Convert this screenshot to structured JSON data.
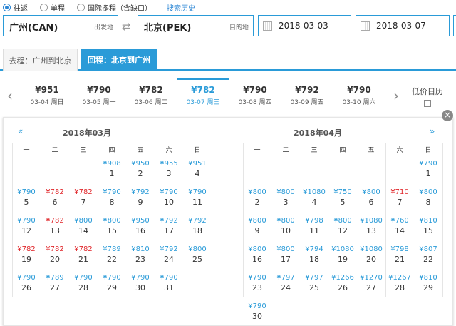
{
  "trip_type": {
    "options": [
      {
        "label": "往返",
        "selected": true
      },
      {
        "label": "单程",
        "selected": false
      },
      {
        "label": "国际多程（含缺口）",
        "selected": false
      }
    ],
    "history_link": "搜索历史"
  },
  "search": {
    "from_city": "广州(CAN)",
    "from_tag": "出发地",
    "to_city": "北京(PEK)",
    "to_tag": "目的地",
    "depart_date": "2018-03-03",
    "return_date": "2018-03-07",
    "swap_icon": "swap-icon",
    "calendar_icon": "calendar-icon"
  },
  "legs": {
    "outbound": "去程：广州到北京",
    "return": "回程：北京到广州"
  },
  "date_strip": {
    "days": [
      {
        "price": "¥951",
        "date": "03-04 周日",
        "selected": false
      },
      {
        "price": "¥790",
        "date": "03-05 周一",
        "selected": false
      },
      {
        "price": "¥782",
        "date": "03-06 周二",
        "selected": false
      },
      {
        "price": "¥782",
        "date": "03-07 周三",
        "selected": true
      },
      {
        "price": "¥790",
        "date": "03-08 周四",
        "selected": false
      },
      {
        "price": "¥792",
        "date": "03-09 周五",
        "selected": false
      },
      {
        "price": "¥790",
        "date": "03-10 周六",
        "selected": false
      }
    ],
    "low_price_calendar": "低价日历"
  },
  "calendar": {
    "close_icon": "×",
    "prev_icon": "«",
    "next_icon": "»",
    "weekdays": [
      "一",
      "二",
      "三",
      "四",
      "五",
      "六",
      "日"
    ],
    "colors": {
      "normal": "#2a9bd8",
      "low": "#e0262a"
    },
    "months": [
      {
        "title": "2018年03月",
        "first_weekday": 3,
        "days": [
          {
            "d": "1",
            "p": "¥908",
            "low": false
          },
          {
            "d": "2",
            "p": "¥950",
            "low": false
          },
          {
            "d": "3",
            "p": "¥955",
            "low": false
          },
          {
            "d": "4",
            "p": "¥951",
            "low": false
          },
          {
            "d": "5",
            "p": "¥790",
            "low": false
          },
          {
            "d": "6",
            "p": "¥782",
            "low": true
          },
          {
            "d": "7",
            "p": "¥782",
            "low": true
          },
          {
            "d": "8",
            "p": "¥790",
            "low": false
          },
          {
            "d": "9",
            "p": "¥792",
            "low": false
          },
          {
            "d": "10",
            "p": "¥790",
            "low": false
          },
          {
            "d": "11",
            "p": "¥790",
            "low": false
          },
          {
            "d": "12",
            "p": "¥790",
            "low": false
          },
          {
            "d": "13",
            "p": "¥782",
            "low": true
          },
          {
            "d": "14",
            "p": "¥800",
            "low": false
          },
          {
            "d": "15",
            "p": "¥800",
            "low": false
          },
          {
            "d": "16",
            "p": "¥950",
            "low": false
          },
          {
            "d": "17",
            "p": "¥792",
            "low": false
          },
          {
            "d": "18",
            "p": "¥792",
            "low": false
          },
          {
            "d": "19",
            "p": "¥782",
            "low": true
          },
          {
            "d": "20",
            "p": "¥782",
            "low": true
          },
          {
            "d": "21",
            "p": "¥782",
            "low": true
          },
          {
            "d": "22",
            "p": "¥789",
            "low": false
          },
          {
            "d": "23",
            "p": "¥810",
            "low": false
          },
          {
            "d": "24",
            "p": "¥792",
            "low": false
          },
          {
            "d": "25",
            "p": "¥800",
            "low": false
          },
          {
            "d": "26",
            "p": "¥790",
            "low": false
          },
          {
            "d": "27",
            "p": "¥789",
            "low": false
          },
          {
            "d": "28",
            "p": "¥790",
            "low": false
          },
          {
            "d": "29",
            "p": "¥790",
            "low": false
          },
          {
            "d": "30",
            "p": "¥790",
            "low": false
          },
          {
            "d": "31",
            "p": "¥790",
            "low": false
          }
        ]
      },
      {
        "title": "2018年04月",
        "first_weekday": 6,
        "days": [
          {
            "d": "1",
            "p": "¥790",
            "low": false
          },
          {
            "d": "2",
            "p": "¥800",
            "low": false
          },
          {
            "d": "3",
            "p": "¥800",
            "low": false
          },
          {
            "d": "4",
            "p": "¥1080",
            "low": false
          },
          {
            "d": "5",
            "p": "¥750",
            "low": false
          },
          {
            "d": "6",
            "p": "¥800",
            "low": false
          },
          {
            "d": "7",
            "p": "¥710",
            "low": true
          },
          {
            "d": "8",
            "p": "¥800",
            "low": false
          },
          {
            "d": "9",
            "p": "¥800",
            "low": false
          },
          {
            "d": "10",
            "p": "¥800",
            "low": false
          },
          {
            "d": "11",
            "p": "¥798",
            "low": false
          },
          {
            "d": "12",
            "p": "¥800",
            "low": false
          },
          {
            "d": "13",
            "p": "¥1080",
            "low": false
          },
          {
            "d": "14",
            "p": "¥760",
            "low": false
          },
          {
            "d": "15",
            "p": "¥810",
            "low": false
          },
          {
            "d": "16",
            "p": "¥800",
            "low": false
          },
          {
            "d": "17",
            "p": "¥800",
            "low": false
          },
          {
            "d": "18",
            "p": "¥794",
            "low": false
          },
          {
            "d": "19",
            "p": "¥1080",
            "low": false
          },
          {
            "d": "20",
            "p": "¥1080",
            "low": false
          },
          {
            "d": "21",
            "p": "¥798",
            "low": false
          },
          {
            "d": "22",
            "p": "¥807",
            "low": false
          },
          {
            "d": "23",
            "p": "¥790",
            "low": false
          },
          {
            "d": "24",
            "p": "¥797",
            "low": false
          },
          {
            "d": "25",
            "p": "¥797",
            "low": false
          },
          {
            "d": "26",
            "p": "¥1266",
            "low": false
          },
          {
            "d": "27",
            "p": "¥1270",
            "low": false
          },
          {
            "d": "28",
            "p": "¥1267",
            "low": false
          },
          {
            "d": "29",
            "p": "¥810",
            "low": false
          },
          {
            "d": "30",
            "p": "¥790",
            "low": false
          }
        ]
      }
    ]
  }
}
